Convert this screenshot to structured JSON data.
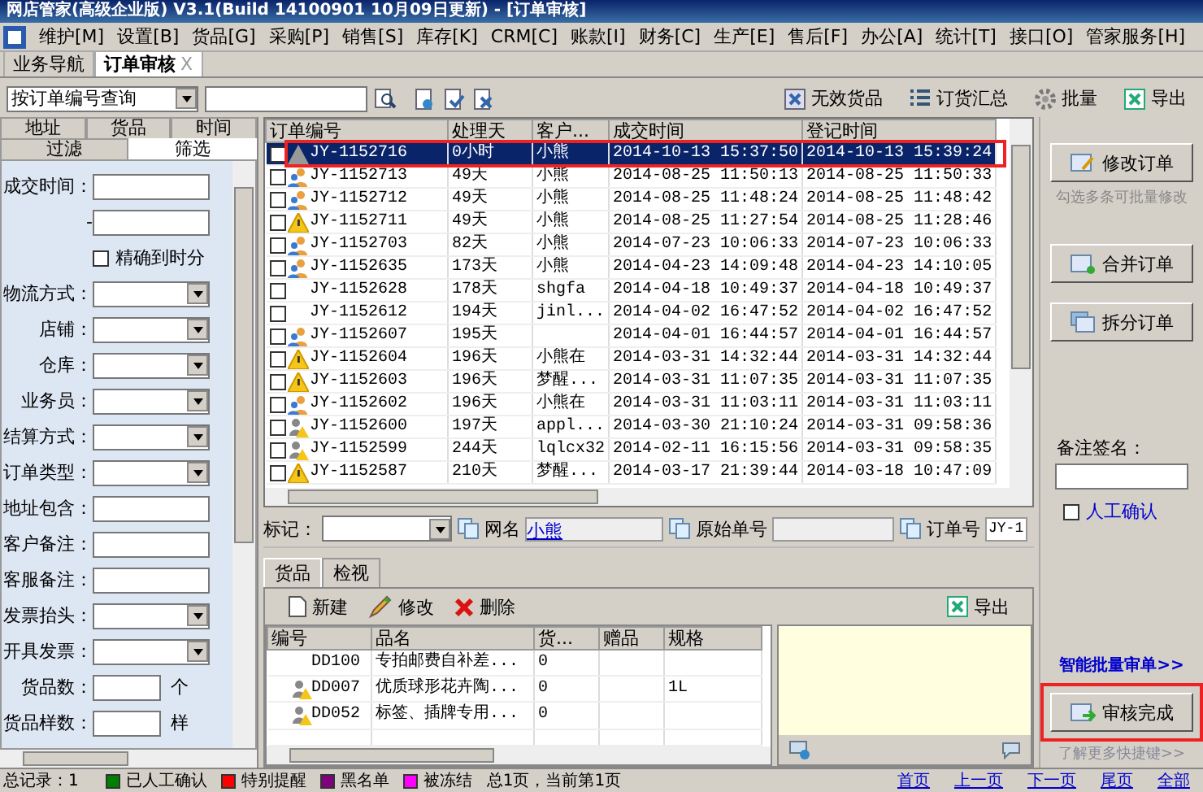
{
  "window": {
    "title": "网店管家(高级企业版) V3.1(Build 14100901 10月09日更新) - [订单审核]"
  },
  "menu": [
    "维护[M]",
    "设置[B]",
    "货品[G]",
    "采购[P]",
    "销售[S]",
    "库存[K]",
    "CRM[C]",
    "账款[I]",
    "财务[C]",
    "生产[E]",
    "售后[F]",
    "办公[A]",
    "统计[T]",
    "接口[O]",
    "管家服务[H]"
  ],
  "doc_tabs": [
    {
      "label": "业务导航",
      "selected": false,
      "closable": false
    },
    {
      "label": "订单审核",
      "selected": true,
      "closable": true,
      "close": "X"
    }
  ],
  "toolbar": {
    "query_type": "按订单编号查询",
    "actions": [
      "无效货品",
      "订货汇总",
      "批量",
      "导出"
    ]
  },
  "filter_tabs": {
    "row1": [
      {
        "label": "地址",
        "selected": false
      },
      {
        "label": "货品",
        "selected": false
      },
      {
        "label": "时间",
        "selected": false
      }
    ],
    "row2": [
      {
        "label": "过滤",
        "selected": false
      },
      {
        "label": "筛选",
        "selected": true
      }
    ]
  },
  "filters": [
    {
      "kind": "text",
      "label": "成交时间："
    },
    {
      "kind": "range",
      "label": "-"
    },
    {
      "kind": "checkbox",
      "label": "精确到时分",
      "checked": false
    },
    {
      "kind": "select",
      "label": "物流方式："
    },
    {
      "kind": "select",
      "label": "店铺："
    },
    {
      "kind": "select",
      "label": "仓库："
    },
    {
      "kind": "select",
      "label": "业务员："
    },
    {
      "kind": "select",
      "label": "结算方式："
    },
    {
      "kind": "select",
      "label": "订单类型："
    },
    {
      "kind": "text",
      "label": "地址包含："
    },
    {
      "kind": "text",
      "label": "客户备注："
    },
    {
      "kind": "text",
      "label": "客服备注："
    },
    {
      "kind": "select",
      "label": "发票抬头："
    },
    {
      "kind": "select",
      "label": "开具发票："
    },
    {
      "kind": "count",
      "label": "货品数：",
      "unit": "个"
    },
    {
      "kind": "count",
      "label": "货品样数：",
      "unit": "样"
    }
  ],
  "orders": {
    "columns": [
      "订单编号",
      "处理天",
      "客户...",
      "成交时间",
      "登记时间"
    ],
    "rows": [
      {
        "kind": "pending",
        "cells": [
          "JY-1152716",
          "0小时",
          "小熊",
          "2014-10-13 15:37:50",
          "2014-10-13 15:39:24"
        ],
        "checked": false,
        "selected": true
      },
      {
        "kind": "people",
        "cells": [
          "JY-1152713",
          "49天",
          "小熊",
          "2014-08-25 11:50:13",
          "2014-08-25 11:50:33"
        ],
        "checked": false,
        "selected": false
      },
      {
        "kind": "people",
        "cells": [
          "JY-1152712",
          "49天",
          "小熊",
          "2014-08-25 11:48:24",
          "2014-08-25 11:48:42"
        ],
        "checked": false,
        "selected": false
      },
      {
        "kind": "warning",
        "cells": [
          "JY-1152711",
          "49天",
          "小熊",
          "2014-08-25 11:27:54",
          "2014-08-25 11:28:46"
        ],
        "checked": false,
        "selected": false
      },
      {
        "kind": "people",
        "cells": [
          "JY-1152703",
          "82天",
          "小熊",
          "2014-07-23 10:06:33",
          "2014-07-23 10:06:33"
        ],
        "checked": false,
        "selected": false
      },
      {
        "kind": "people",
        "cells": [
          "JY-1152635",
          "173天",
          "小熊",
          "2014-04-23 14:09:48",
          "2014-04-23 14:10:05"
        ],
        "checked": false,
        "selected": false
      },
      {
        "kind": "plain",
        "cells": [
          "JY-1152628",
          "178天",
          "shgfa",
          "2014-04-18 10:49:37",
          "2014-04-18 10:49:37"
        ],
        "checked": false,
        "selected": false
      },
      {
        "kind": "plain",
        "cells": [
          "JY-1152612",
          "194天",
          "jinl...",
          "2014-04-02 16:47:52",
          "2014-04-02 16:47:52"
        ],
        "checked": false,
        "selected": false
      },
      {
        "kind": "people",
        "cells": [
          "JY-1152607",
          "195天",
          "",
          "2014-04-01 16:44:57",
          "2014-04-01 16:44:57"
        ],
        "checked": false,
        "selected": false
      },
      {
        "kind": "warning",
        "cells": [
          "JY-1152604",
          "196天",
          "小熊在",
          "2014-03-31 14:32:44",
          "2014-03-31 14:32:44"
        ],
        "checked": false,
        "selected": false
      },
      {
        "kind": "warning",
        "cells": [
          "JY-1152603",
          "196天",
          "梦醒...",
          "2014-03-31 11:07:35",
          "2014-03-31 11:07:35"
        ],
        "checked": false,
        "selected": false
      },
      {
        "kind": "people",
        "cells": [
          "JY-1152602",
          "196天",
          "小熊在",
          "2014-03-31 11:03:11",
          "2014-03-31 11:03:11"
        ],
        "checked": false,
        "selected": false
      },
      {
        "kind": "userwarn",
        "cells": [
          "JY-1152600",
          "197天",
          "appl...",
          "2014-03-30 21:10:24",
          "2014-03-31 09:58:36"
        ],
        "checked": false,
        "selected": false
      },
      {
        "kind": "userwarn",
        "cells": [
          "JY-1152599",
          "244天",
          "lqlcx32",
          "2014-02-11 16:15:56",
          "2014-03-31 09:58:35"
        ],
        "checked": false,
        "selected": false
      },
      {
        "kind": "warning",
        "cells": [
          "JY-1152587",
          "210天",
          "梦醒...",
          "2014-03-17 21:39:44",
          "2014-03-18 10:47:09"
        ],
        "checked": false,
        "selected": false
      }
    ]
  },
  "detail": {
    "mark_label": "标记：",
    "net_name_label": "网名",
    "net_name": "小熊",
    "original_no_label": "原始单号",
    "order_no_label": "订单号",
    "order_no": "JY-1"
  },
  "goods_tabs": [
    {
      "label": "货品",
      "selected": true
    },
    {
      "label": "检视",
      "selected": false
    }
  ],
  "goods_actions": [
    "新建",
    "修改",
    "删除"
  ],
  "goods_export": "导出",
  "goods": {
    "columns": [
      "编号",
      "品名",
      "货...",
      "赠品",
      "规格"
    ],
    "rows": [
      {
        "kind": "plain",
        "cells": [
          "DD100",
          "专拍邮费自补差...",
          "0",
          "",
          ""
        ]
      },
      {
        "kind": "userwarn",
        "cells": [
          "DD007",
          "优质球形花卉陶...",
          "0",
          "",
          "1L"
        ]
      },
      {
        "kind": "userwarn",
        "cells": [
          "DD052",
          "标签、插牌专用...",
          "0",
          "",
          ""
        ]
      }
    ]
  },
  "side": {
    "edit_order": "修改订单",
    "batch_hint": "勾选多条可批量修改",
    "merge_order": "合并订单",
    "split_order": "拆分订单",
    "sign_label": "备注签名：",
    "manual_confirm": "人工确认",
    "manual_checked": false,
    "smart_batch": "智能批量审单>>",
    "finish": "审核完成",
    "more_keys": "了解更多快捷键>>"
  },
  "status": {
    "total": "总记录：1",
    "legend": [
      {
        "label": "已人工确认",
        "color": "#008000"
      },
      {
        "label": "特别提醒",
        "color": "#ff0000"
      },
      {
        "label": "黑名单",
        "color": "#800080"
      },
      {
        "label": "被冻结",
        "color": "#ff00ff"
      }
    ],
    "pages": "总1页，当前第1页",
    "nav": [
      "首页",
      "上一页",
      "下一页",
      "尾页",
      "全部"
    ]
  }
}
